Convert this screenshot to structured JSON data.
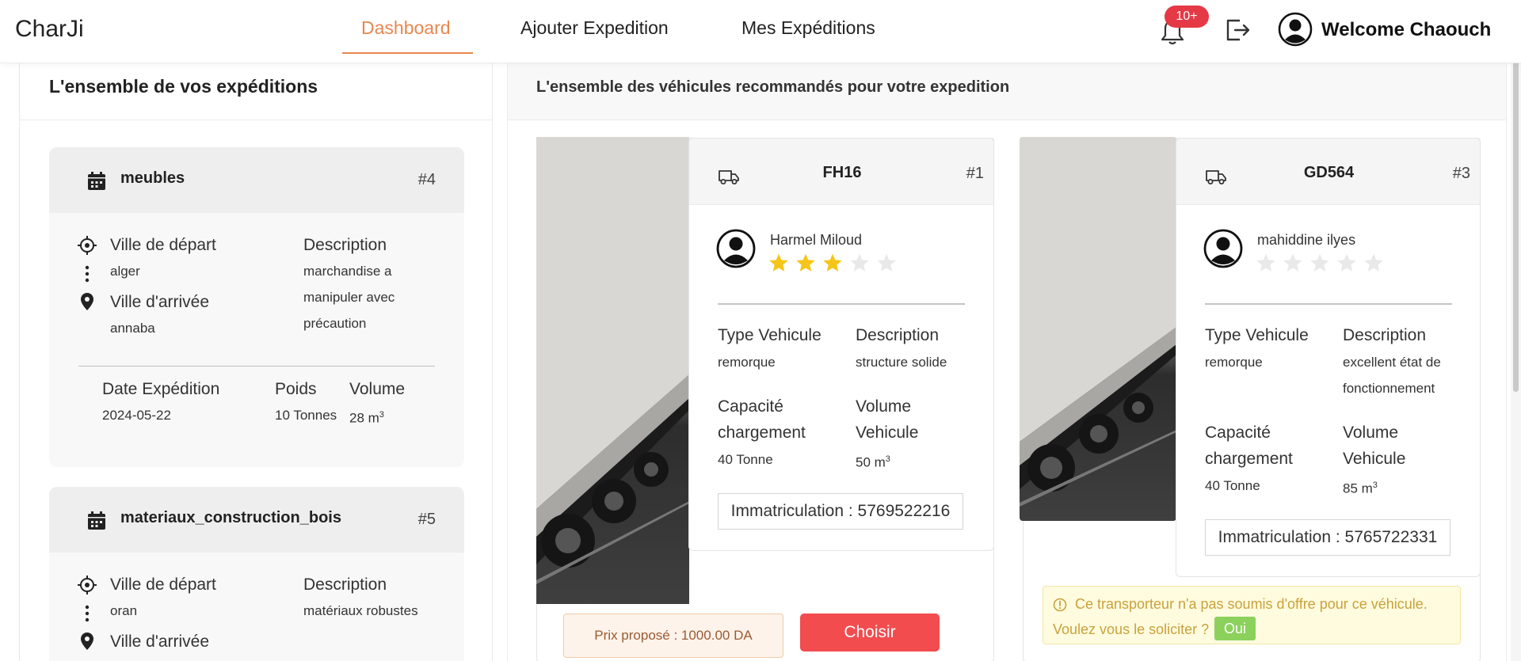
{
  "navbar": {
    "brand": "CharJi",
    "links": [
      {
        "label": "Dashboard",
        "active": true
      },
      {
        "label": "Ajouter Expedition",
        "active": false
      },
      {
        "label": "Mes Expéditions",
        "active": false
      }
    ],
    "notifications_badge": "10+",
    "welcome": "Welcome Chaouch",
    "accent_color": "#e8874f"
  },
  "left_panel": {
    "title": "L'ensemble de vos expéditions",
    "expeditions": [
      {
        "name": "meubles",
        "number": "#4",
        "depart_label": "Ville de départ",
        "depart": "alger",
        "arrivee_label": "Ville d'arrivée",
        "arrivee": "annaba",
        "description_label": "Description",
        "description_lines": [
          "marchandise a",
          "manipuler avec",
          "précaution"
        ],
        "date_label": "Date Expédition",
        "date": "2024-05-22",
        "poids_label": "Poids",
        "poids": "10 Tonnes",
        "volume_label": "Volume",
        "volume": "28 m",
        "volume_unit_sup": "3"
      },
      {
        "name": "materiaux_construction_bois",
        "number": "#5",
        "depart_label": "Ville de départ",
        "depart": "oran",
        "arrivee_label": "Ville d'arrivée",
        "description_label": "Description",
        "description_lines": [
          "matériaux robustes"
        ]
      }
    ]
  },
  "right_panel": {
    "title": "L'ensemble des véhicules recommandés pour votre expedition",
    "vehicles": [
      {
        "name": "FH16",
        "number": "#1",
        "driver": "Harmel Miloud",
        "rating": 3,
        "rating_max": 5,
        "type_label": "Type Vehicule",
        "type": "remorque",
        "description_label": "Description",
        "description_lines": [
          "structure solide"
        ],
        "capacite_label_lines": [
          "Capacité",
          "chargement"
        ],
        "capacite": "40 Tonne",
        "volume_label_lines": [
          "Volume",
          "Vehicule"
        ],
        "volume": "50 m",
        "volume_unit_sup": "3",
        "immatriculation": "Immatriculation : 5769522216",
        "price": "Prix proposé : 1000.00 DA",
        "choose_label": "Choisir"
      },
      {
        "name": "GD564",
        "number": "#3",
        "driver": "mahiddine ilyes",
        "rating": 0,
        "rating_max": 5,
        "type_label": "Type Vehicule",
        "type": "remorque",
        "description_label": "Description",
        "description_lines": [
          "excellent état de",
          "fonctionnement"
        ],
        "capacite_label_lines": [
          "Capacité",
          "chargement"
        ],
        "capacite": "40 Tonne",
        "volume_label_lines": [
          "Volume",
          "Vehicule"
        ],
        "volume": "85 m",
        "volume_unit_sup": "3",
        "immatriculation": "Immatriculation : 5765722331",
        "warning": "Ce transporteur n'a pas soumis d'offre pour ce véhicule.",
        "warning_question": "Voulez vous le soliciter ?",
        "oui_label": "Oui"
      }
    ]
  },
  "colors": {
    "star_filled": "#f5c518",
    "star_empty": "#e9e9e9",
    "choose_button": "#f24c4f",
    "oui_button": "#8bd15c",
    "badge": "#e53945"
  }
}
